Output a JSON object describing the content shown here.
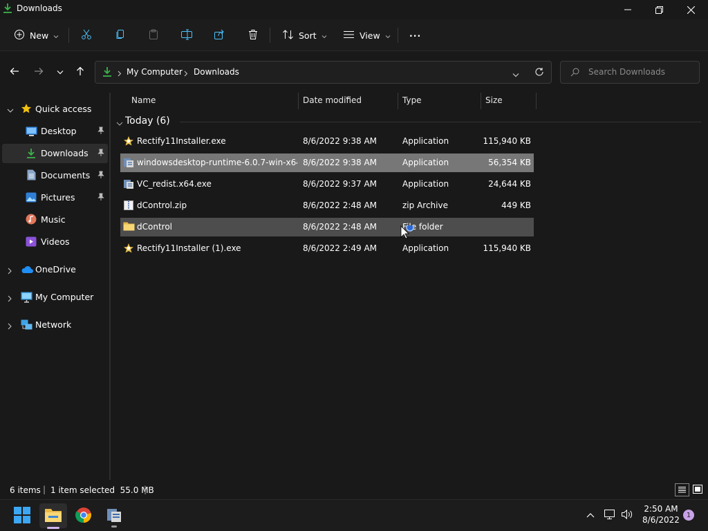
{
  "window": {
    "title": "Downloads"
  },
  "toolbar": {
    "new_label": "New",
    "sort_label": "Sort",
    "view_label": "View",
    "more_label": "···"
  },
  "address": {
    "crumbs": [
      "My Computer",
      "Downloads"
    ]
  },
  "search": {
    "placeholder": "Search Downloads"
  },
  "sidebar": {
    "quick_access": "Quick access",
    "items": [
      {
        "label": "Desktop",
        "icon": "desktop-icon",
        "pinned": true
      },
      {
        "label": "Downloads",
        "icon": "download-icon",
        "pinned": true,
        "selected": true
      },
      {
        "label": "Documents",
        "icon": "documents-icon",
        "pinned": true
      },
      {
        "label": "Pictures",
        "icon": "pictures-icon",
        "pinned": true
      },
      {
        "label": "Music",
        "icon": "music-icon"
      },
      {
        "label": "Videos",
        "icon": "videos-icon"
      }
    ],
    "roots": [
      "OneDrive",
      "My Computer",
      "Network"
    ]
  },
  "columns": {
    "name": "Name",
    "date": "Date modified",
    "type": "Type",
    "size": "Size"
  },
  "group": {
    "label": "Today (6)"
  },
  "files": [
    {
      "name": "Rectify11Installer.exe",
      "date": "8/6/2022 9:38 AM",
      "type": "Application",
      "size": "115,940 KB",
      "icon": "installer-icon"
    },
    {
      "name": "windowsdesktop-runtime-6.0.7-win-x64....",
      "date": "8/6/2022 9:38 AM",
      "type": "Application",
      "size": "56,354 KB",
      "icon": "setup-icon",
      "state": "selected"
    },
    {
      "name": "VC_redist.x64.exe",
      "date": "8/6/2022 9:37 AM",
      "type": "Application",
      "size": "24,644 KB",
      "icon": "setup-icon"
    },
    {
      "name": "dControl.zip",
      "date": "8/6/2022 2:48 AM",
      "type": "zip Archive",
      "size": "449 KB",
      "icon": "zip-icon"
    },
    {
      "name": "dControl",
      "date": "8/6/2022 2:48 AM",
      "type": "File folder",
      "size": "",
      "icon": "folder-icon",
      "state": "hover"
    },
    {
      "name": "Rectify11Installer (1).exe",
      "date": "8/6/2022 2:49 AM",
      "type": "Application",
      "size": "115,940 KB",
      "icon": "installer-icon"
    }
  ],
  "status": {
    "items": "6 items",
    "selection": "1 item selected  55.0 MB"
  },
  "taskbar": {
    "time": "2:50 AM",
    "date": "8/6/2022",
    "badge": "1"
  },
  "colors": {
    "accent": "#4cc2ff",
    "download_green": "#3bb44a",
    "selected_row": "#777777",
    "hover_row": "#4d4d4d"
  }
}
